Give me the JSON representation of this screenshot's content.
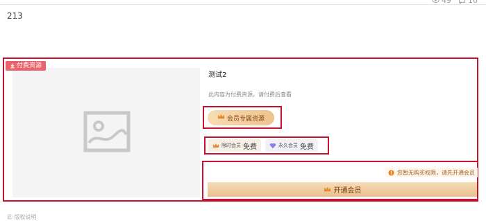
{
  "post": {
    "views": "49",
    "comments": "16",
    "body_text": "213"
  },
  "resource": {
    "paid_tag": "付费资源",
    "title": "测试2",
    "description": "此内容为付费资源，请付费后查看",
    "vip_label": "会员专属资源",
    "tiers": [
      {
        "label": "限时会员",
        "value": "免费"
      },
      {
        "label": "永久会员",
        "value": "免费"
      }
    ],
    "notice": "您暂无购买权限，请先开通会员",
    "open_button": "开通会员"
  },
  "footer": {
    "text": "㊣ 版权说明"
  },
  "colors": {
    "highlight_border": "#c8102e",
    "paid_tag": "#e8636b",
    "gold_gradient_start": "#f6dcb7",
    "gold_gradient_end": "#e9c08e",
    "notice_text": "#a86122"
  }
}
